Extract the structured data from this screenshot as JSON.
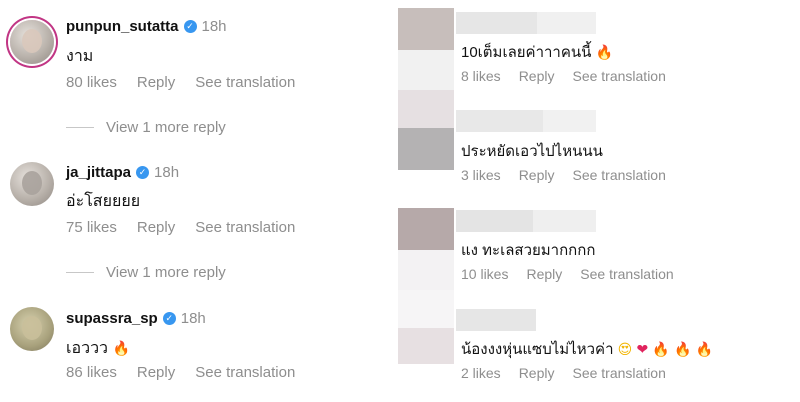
{
  "left_comments": [
    {
      "username": "punpun_sutatta",
      "time": "18h",
      "text": "งาม",
      "likes": "80 likes",
      "reply": "Reply",
      "translate": "See translation",
      "more_replies": "View 1 more reply"
    },
    {
      "username": "ja_jittapa",
      "time": "18h",
      "text": "อ่ะโสยยยย",
      "likes": "75 likes",
      "reply": "Reply",
      "translate": "See translation",
      "more_replies": "View 1 more reply"
    },
    {
      "username": "supassra_sp",
      "time": "18h",
      "text": "เอววว",
      "likes": "86 likes",
      "reply": "Reply",
      "translate": "See translation"
    }
  ],
  "right_comments": [
    {
      "text": "10เต็มเลยค่าาาคนนี้",
      "likes": "8 likes",
      "reply": "Reply",
      "translate": "See translation"
    },
    {
      "text": "ประหยัดเอวไปไหนนน",
      "likes": "3 likes",
      "reply": "Reply",
      "translate": "See translation"
    },
    {
      "text": "แง ทะเลสวยมากกกก",
      "likes": "10 likes",
      "reply": "Reply",
      "translate": "See translation"
    },
    {
      "text": "น้องงงหุ่นแซบไม่ไหวค่า",
      "likes": "2 likes",
      "reply": "Reply",
      "translate": "See translation"
    }
  ],
  "icons": {
    "verified": "verified-badge-icon",
    "fire": "fire-emoji",
    "heart": "red-heart-emoji",
    "heart_eyes": "heart-eyes-emoji"
  },
  "colors": {
    "verified": "#3897f0",
    "secondary_text": "#8e8e8e",
    "story_ring": "#c13584"
  }
}
